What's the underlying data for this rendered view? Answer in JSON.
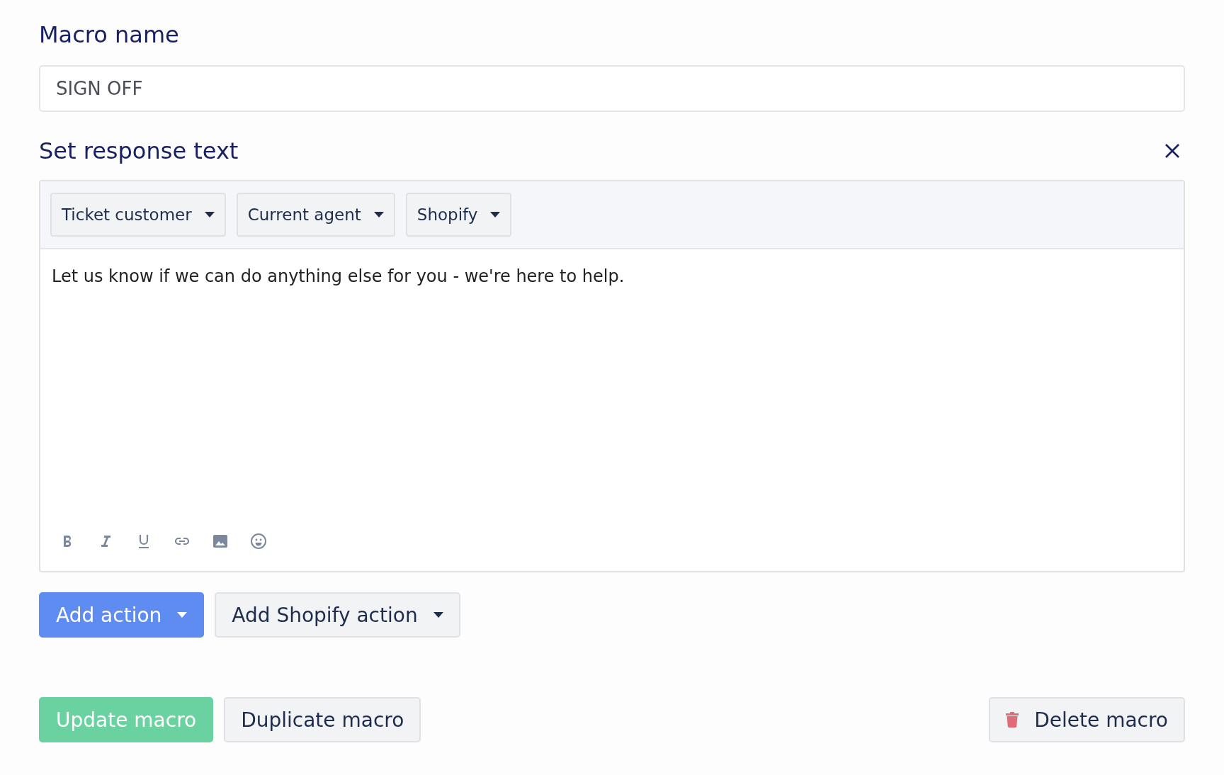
{
  "macro_name": {
    "label": "Macro name",
    "value": "SIGN OFF"
  },
  "response": {
    "title": "Set response text",
    "variable_menus": [
      {
        "label": "Ticket customer"
      },
      {
        "label": "Current agent"
      },
      {
        "label": "Shopify"
      }
    ],
    "body_text": "Let us know if we can do anything else for you - we're here to help."
  },
  "actions": [
    {
      "label": "Add action",
      "kind": "primary"
    },
    {
      "label": "Add Shopify action",
      "kind": "secondary"
    }
  ],
  "footer_buttons": [
    {
      "label": "Update macro",
      "kind": "success"
    },
    {
      "label": "Duplicate macro",
      "kind": "secondary"
    },
    {
      "label": "Delete macro",
      "kind": "danger"
    }
  ]
}
